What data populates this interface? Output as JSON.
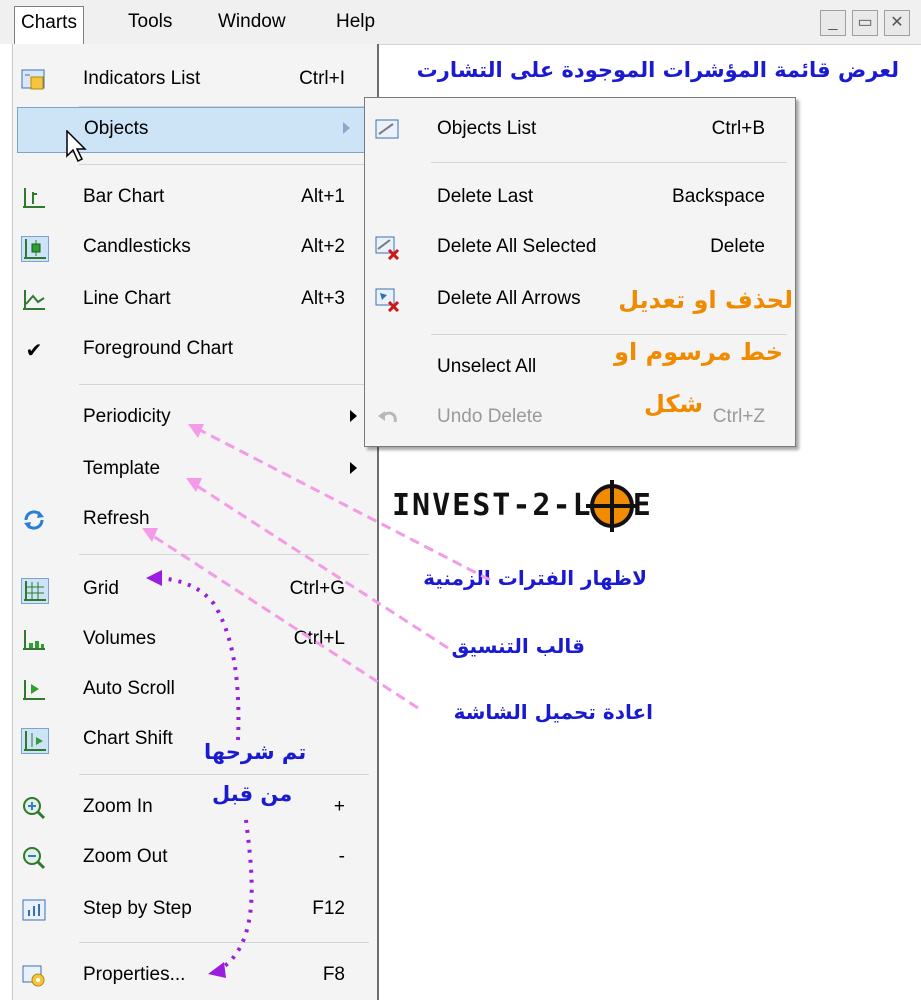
{
  "menubar": {
    "items": [
      "Charts",
      "Tools",
      "Window",
      "Help"
    ],
    "controls": [
      "_",
      "▭",
      "✕"
    ]
  },
  "menu": {
    "items": [
      {
        "label": "Indicators List",
        "shortcut": "Ctrl+I",
        "icon": "indicators-list-icon"
      },
      {
        "label": "Objects",
        "shortcut": "",
        "icon": "",
        "submenu": true,
        "highlighted": true
      },
      {
        "label": "Bar Chart",
        "shortcut": "Alt+1",
        "icon": "bar-chart-icon"
      },
      {
        "label": "Candlesticks",
        "shortcut": "Alt+2",
        "icon": "candlesticks-icon"
      },
      {
        "label": "Line Chart",
        "shortcut": "Alt+3",
        "icon": "line-chart-icon"
      },
      {
        "label": "Foreground Chart",
        "shortcut": "",
        "icon": "checkmark-icon"
      },
      {
        "label": "Periodicity",
        "shortcut": "",
        "icon": "",
        "submenu": true
      },
      {
        "label": "Template",
        "shortcut": "",
        "icon": "",
        "submenu": true
      },
      {
        "label": "Refresh",
        "shortcut": "",
        "icon": "refresh-icon"
      },
      {
        "label": "Grid",
        "shortcut": "Ctrl+G",
        "icon": "grid-icon"
      },
      {
        "label": "Volumes",
        "shortcut": "Ctrl+L",
        "icon": "volumes-icon"
      },
      {
        "label": "Auto Scroll",
        "shortcut": "",
        "icon": "auto-scroll-icon"
      },
      {
        "label": "Chart Shift",
        "shortcut": "",
        "icon": "chart-shift-icon"
      },
      {
        "label": "Zoom In",
        "shortcut": "+",
        "icon": "zoom-in-icon"
      },
      {
        "label": "Zoom Out",
        "shortcut": "-",
        "icon": "zoom-out-icon"
      },
      {
        "label": "Step by Step",
        "shortcut": "F12",
        "icon": "step-by-step-icon"
      },
      {
        "label": "Properties...",
        "shortcut": "F8",
        "icon": "properties-icon"
      }
    ]
  },
  "submenu": {
    "items": [
      {
        "label": "Objects List",
        "shortcut": "Ctrl+B",
        "icon": "objects-list-icon"
      },
      {
        "label": "Delete Last",
        "shortcut": "Backspace",
        "icon": ""
      },
      {
        "label": "Delete All Selected",
        "shortcut": "Delete",
        "icon": "delete-selected-icon"
      },
      {
        "label": "Delete All Arrows",
        "shortcut": "",
        "icon": "delete-arrows-icon"
      },
      {
        "label": "Unselect All",
        "shortcut": "",
        "icon": ""
      },
      {
        "label": "Undo Delete",
        "shortcut": "Ctrl+Z",
        "icon": "undo-icon",
        "disabled": true
      }
    ]
  },
  "annotations": {
    "indicators": "لعرض قائمة المؤشرات الموجودة على التشارت",
    "delete_line1": "لحذف او تعديل",
    "delete_line2": "خط مرسوم او",
    "delete_line3": "شكل",
    "periodicity": "لاظهار الفترات الزمنية",
    "template": "قالب التنسيق",
    "refresh": "اعادة تحميل الشاشة",
    "explained_line1": "تم شرحها",
    "explained_line2": "من قبل"
  },
  "logo": {
    "text": "INVEST-2-LIFE"
  },
  "colors": {
    "annotation_blue": "#1a1ad0",
    "annotation_orange": "#f08a00",
    "arrow_pink": "#f39be6",
    "arrow_purple": "#9b1de0",
    "highlight": "#cde4f7"
  }
}
